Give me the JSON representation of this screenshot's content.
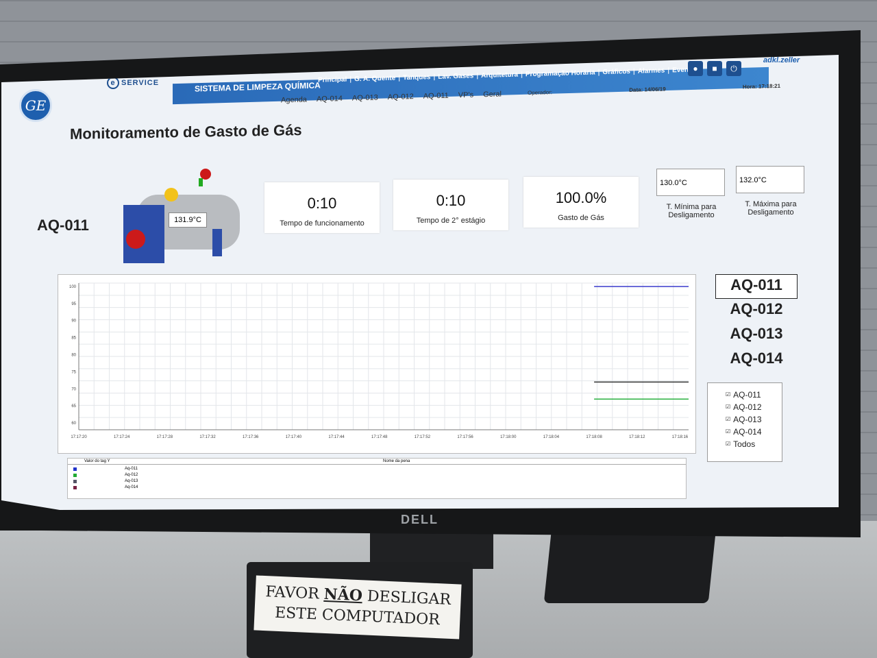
{
  "header": {
    "system_title": "SISTEMA DE LIMPEZA QUÍMICA",
    "brand_eservice": "SERVICE",
    "vendor_logo": "adkl.zeller",
    "ge_logo": "GE",
    "main_menu": [
      "Principal",
      "G. A. Quente",
      "Tanques",
      "Lav. Gases",
      "Arquitetura",
      "Programação Horária",
      "Gráficos",
      "Alarmes",
      "Eventos"
    ],
    "sub_menu": [
      "Agenda",
      "AQ-014",
      "AQ-013",
      "AQ-012",
      "AQ-011",
      "VP's",
      "Geral"
    ],
    "operator_label": "Operador:",
    "date_label": "Data:",
    "date_value": "14/06/19",
    "time_label": "Hora:",
    "time_value": "17:18:21",
    "icons": [
      "user-icon",
      "lock-icon",
      "power-icon"
    ]
  },
  "page": {
    "title": "Monitoramento de Gasto de Gás",
    "equipment": "AQ-011",
    "equipment_temp": "131.9°C"
  },
  "kpis": [
    {
      "value": "0:10",
      "label": "Tempo de funcionamento"
    },
    {
      "value": "0:10",
      "label": "Tempo de 2° estágio"
    },
    {
      "value": "100.0%",
      "label": "Gasto de Gás"
    }
  ],
  "setpoints": {
    "min_value": "130.0°C",
    "min_label_1": "T. Mínima para",
    "min_label_2": "Desligamento",
    "max_value": "132.0°C",
    "max_label_1": "T. Máxima para",
    "max_label_2": "Desligamento"
  },
  "plot_selector": [
    "AQ-011",
    "AQ-012",
    "AQ-013",
    "AQ-014"
  ],
  "legend": {
    "items": [
      "AQ-011",
      "AQ-012",
      "AQ-013",
      "AQ-014"
    ],
    "all_label": "Todos"
  },
  "pen_table": {
    "col1": "Valor do tag Y",
    "col2": "Nome da pena",
    "rows": [
      {
        "name": "Aq-011",
        "color": "#2233cc"
      },
      {
        "name": "Aq-012",
        "color": "#22aa33"
      },
      {
        "name": "Aq-013",
        "color": "#555566"
      },
      {
        "name": "Aq-014",
        "color": "#772244"
      }
    ]
  },
  "other_text": {
    "monitor_brand": "DELL",
    "sticker_line1_pre": "FAVOR ",
    "sticker_line1_em": "NÃO",
    "sticker_line1_post": " DESLIGAR",
    "sticker_line2": "ESTE COMPUTADOR"
  },
  "chart_data": {
    "type": "line",
    "title": "",
    "xlabel": "",
    "ylabel": "",
    "x_ticks": [
      "17:17:20",
      "17:17:24",
      "17:17:28",
      "17:17:32",
      "17:17:36",
      "17:17:40",
      "17:17:44",
      "17:17:48",
      "17:17:52",
      "17:17:56",
      "17:18:00",
      "17:18:04",
      "17:18:08",
      "17:18:12",
      "17:18:16"
    ],
    "y_ticks": [
      100,
      95,
      90,
      85,
      80,
      75,
      70,
      65,
      60
    ],
    "ylim": [
      58,
      101
    ],
    "grid": true,
    "series": [
      {
        "name": "Aq-011",
        "color": "#3a3acc",
        "x": [
          "17:18:08",
          "17:18:20"
        ],
        "values": [
          100,
          100
        ]
      },
      {
        "name": "Aq-013",
        "color": "#333333",
        "x": [
          "17:18:08",
          "17:18:20"
        ],
        "values": [
          72,
          72
        ]
      },
      {
        "name": "Aq-012",
        "color": "#2ab040",
        "x": [
          "17:18:08",
          "17:18:20"
        ],
        "values": [
          67,
          67
        ]
      }
    ]
  }
}
